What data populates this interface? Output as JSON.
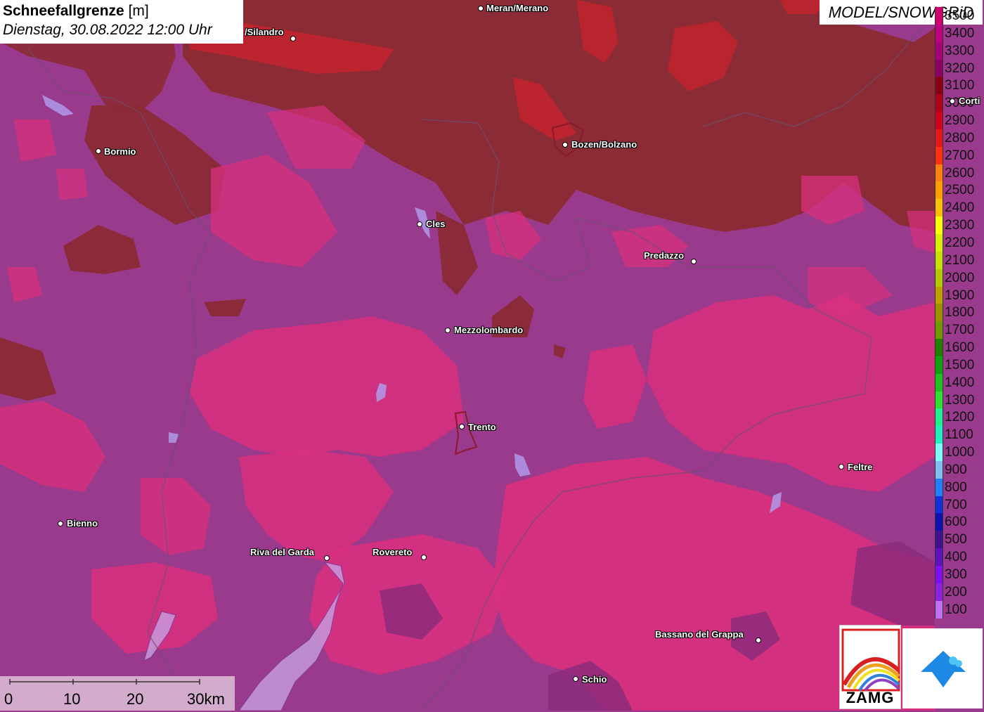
{
  "title": {
    "label": "Schneefallgrenze",
    "unit": "[m]",
    "datetime": "Dienstag, 30.08.2022 12:00 Uhr"
  },
  "model_label": "MODEL/SNOWGRiD",
  "legend": [
    {
      "label": "3500",
      "color": "#d0006e"
    },
    {
      "label": "3400",
      "color": "#c00080"
    },
    {
      "label": "3300",
      "color": "#a8007a"
    },
    {
      "label": "3200",
      "color": "#8c0064"
    },
    {
      "label": "3100",
      "color": "#8a0010"
    },
    {
      "label": "3000",
      "color": "#b0001a"
    },
    {
      "label": "2900",
      "color": "#d00018"
    },
    {
      "label": "2800",
      "color": "#e81818"
    },
    {
      "label": "2700",
      "color": "#ff3010"
    },
    {
      "label": "2600",
      "color": "#ff8010"
    },
    {
      "label": "2500",
      "color": "#ffa000"
    },
    {
      "label": "2400",
      "color": "#ffc000"
    },
    {
      "label": "2300",
      "color": "#ffff00"
    },
    {
      "label": "2200",
      "color": "#d8f000"
    },
    {
      "label": "2100",
      "color": "#c8e000"
    },
    {
      "label": "2000",
      "color": "#b8c800"
    },
    {
      "label": "1900",
      "color": "#c0a000"
    },
    {
      "label": "1800",
      "color": "#a09000"
    },
    {
      "label": "1700",
      "color": "#709800"
    },
    {
      "label": "1600",
      "color": "#208000"
    },
    {
      "label": "1500",
      "color": "#10a010"
    },
    {
      "label": "1400",
      "color": "#20c020"
    },
    {
      "label": "1300",
      "color": "#30e030"
    },
    {
      "label": "1200",
      "color": "#20f090"
    },
    {
      "label": "1100",
      "color": "#20f0c0"
    },
    {
      "label": "1000",
      "color": "#80f8f8"
    },
    {
      "label": "900",
      "color": "#80c0f0"
    },
    {
      "label": "800",
      "color": "#2080ff"
    },
    {
      "label": "700",
      "color": "#1030e0"
    },
    {
      "label": "600",
      "color": "#1010b0"
    },
    {
      "label": "500",
      "color": "#401090"
    },
    {
      "label": "400",
      "color": "#6010c0"
    },
    {
      "label": "300",
      "color": "#8010f0"
    },
    {
      "label": "200",
      "color": "#9020e0"
    },
    {
      "label": "100",
      "color": "#c070f0"
    }
  ],
  "cities": [
    {
      "name": "Meran/Merano"
    },
    {
      "name": "/Silandro"
    },
    {
      "name": "Bormio"
    },
    {
      "name": "Bozen/Bolzano"
    },
    {
      "name": "Cles"
    },
    {
      "name": "Predazzo"
    },
    {
      "name": "Mezzolombardo"
    },
    {
      "name": "Trento"
    },
    {
      "name": "Feltre"
    },
    {
      "name": "Bienno"
    },
    {
      "name": "Riva del Garda"
    },
    {
      "name": "Rovereto"
    },
    {
      "name": "Bassano del Grappa"
    },
    {
      "name": "Schio"
    },
    {
      "name": "Corti"
    }
  ],
  "scale": {
    "labels": [
      "0",
      "10",
      "20",
      "30km"
    ]
  },
  "logo_text": "ZAMG",
  "colors": {
    "base": "#9a3a8c",
    "pink": "#d8307e",
    "brown": "#8a2a30",
    "red": "#c4242e"
  }
}
